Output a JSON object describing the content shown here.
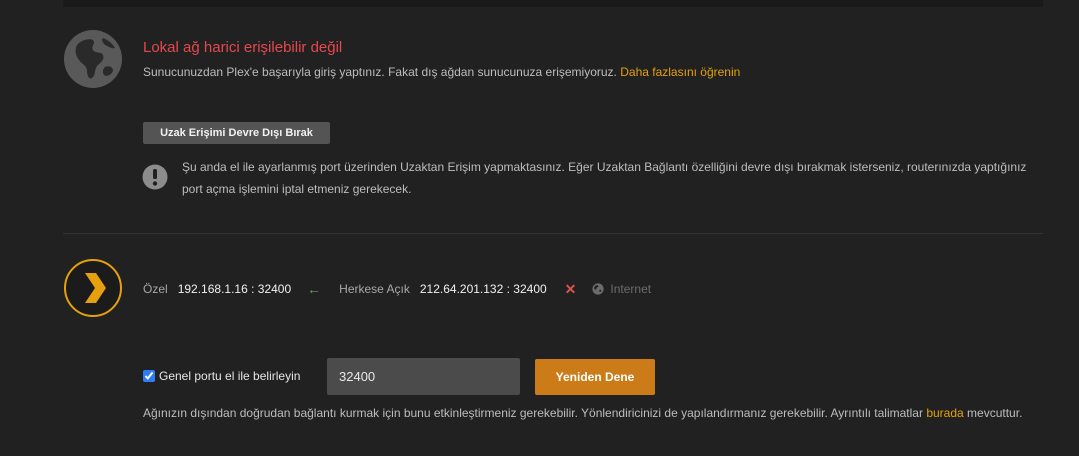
{
  "status": {
    "title": "Lokal ağ harici erişilebilir değil",
    "description": "Sunucunuzdan Plex'e başarıyla giriş yaptınız. Fakat dış ağdan sunucunuza erişemiyoruz.",
    "learn_more_link": "Daha fazlasını öğrenin",
    "icon": "globe-icon",
    "title_color": "#e5484d"
  },
  "remote_access": {
    "disable_button": "Uzak Erişimi Devre Dışı Bırak",
    "warning_icon": "exclamation-circle-icon",
    "warning_text": "Şu anda el ile ayarlanmış port üzerinden Uzaktan Erişim yapmaktasınız. Eğer Uzaktan Bağlantı özelliğini devre dışı bırakmak isterseniz, routerınızda yaptığınız port açma işlemini iptal etmeniz gerekecek."
  },
  "connection": {
    "logo_icon": "plex-chevron-icon",
    "private_label": "Özel",
    "private_ip": "192.168.1.16",
    "private_port": "32400",
    "separator": " : ",
    "arrow_icon": "arrow-left-icon",
    "public_label": "Herkese Açık",
    "public_ip": "212.64.201.132",
    "public_port": "32400",
    "fail_icon": "x-mark-icon",
    "internet_icon": "globe-icon",
    "internet_label": "Internet",
    "ok_color": "#65a851",
    "fail_color": "#d9534f"
  },
  "port": {
    "checkbox_label": "Genel portu el ile belirleyin",
    "checked": true,
    "value": "32400",
    "retry_button": "Yeniden Dene",
    "accent_color": "#cc7b19"
  },
  "help": {
    "text": "Ağınızın dışından doğrudan bağlantı kurmak için bunu etkinleştirmeniz gerekebilir. Yönlendiricinizi de yapılandırmanız gerekebilir. Ayrıntılı talimatlar",
    "link": "burada",
    "suffix": "mevcuttur."
  }
}
